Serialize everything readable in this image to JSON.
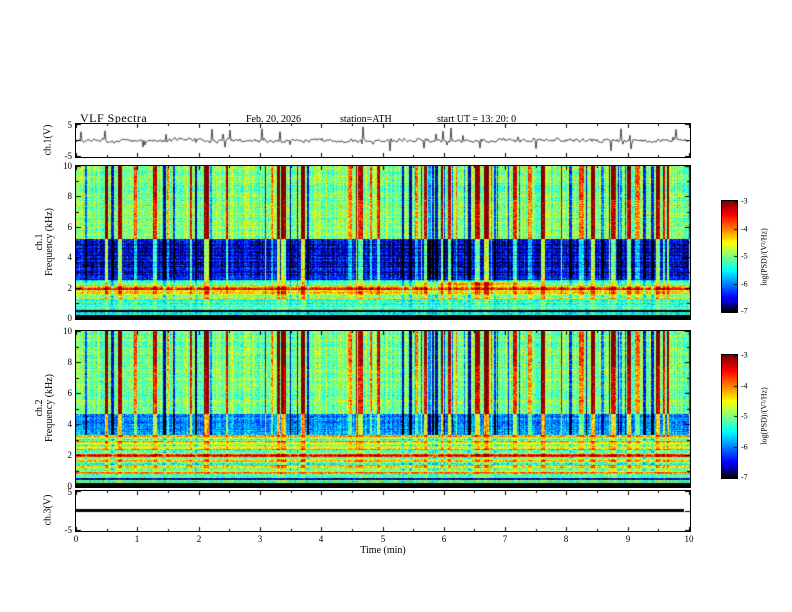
{
  "title": "VLF Spectra",
  "header": {
    "date": "Feb. 20, 2026",
    "station": "station=ATH",
    "start_ut": "start UT =  13: 20: 0"
  },
  "xaxis": {
    "label": "Time (min)",
    "range": [
      0,
      10
    ],
    "ticks": [
      0,
      1,
      2,
      3,
      4,
      5,
      6,
      7,
      8,
      9,
      10
    ]
  },
  "chart_data": [
    {
      "type": "line",
      "name": "ch.1 time series",
      "ylabel": "ch.1(V)",
      "ylim": [
        -5,
        5
      ],
      "yticks": [
        5,
        -5
      ],
      "x_range": [
        0,
        10
      ],
      "description": "Broadband noisy waveform centred on 0 V, typical excursions within about ±1 V, with frequent impulsive spikes reaching roughly ±4 V across the full 10 minutes"
    },
    {
      "type": "heatmap",
      "name": "ch.1 spectrogram",
      "channel": "ch.1",
      "ylabel": "Frequency (kHz)",
      "ylim": [
        0,
        10
      ],
      "yticks": [
        0,
        2,
        4,
        6,
        8,
        10
      ],
      "value_range_log_psd": [
        -7,
        -3
      ],
      "colorbar": {
        "label": "log(PSD)/(V²/Hz)",
        "ticks": [
          -3,
          -4,
          -5,
          -6,
          -7
        ]
      },
      "features": [
        "black band below ~0.2 kHz",
        "bright yellow-green band 1.6-2.1 kHz with an orange line near 2 kHz",
        "dark blue attenuation band ~2.5-5 kHz",
        "mottled green background 5-10 kHz",
        "dense vertical sferic striations spanning the band, strongest (orange/red near -3) above ~8 kHz",
        "occasional dark dropout columns",
        "isolated yellow streak near 2.3 kHz around 5.5-7.5 min"
      ]
    },
    {
      "type": "heatmap",
      "name": "ch.2 spectrogram",
      "channel": "ch.2",
      "ylabel": "Frequency (kHz)",
      "ylim": [
        0,
        10
      ],
      "yticks": [
        0,
        2,
        4,
        6,
        8,
        10
      ],
      "value_range_log_psd": [
        -7,
        -3
      ],
      "colorbar": {
        "label": "log(PSD)/(V²/Hz)",
        "ticks": [
          -3,
          -4,
          -5,
          -6,
          -7
        ]
      },
      "features": [
        "black band below ~0.2 kHz",
        "stack of horizontal harmonic lines 0.3-3.3 kHz with a strong orange line near 2 kHz",
        "blue band ~3.3-4.7 kHz",
        "mottled green background above 4.7 kHz with dense vertical sferic striations"
      ]
    },
    {
      "type": "line",
      "name": "ch.3 time series",
      "ylabel": "ch.3(V)",
      "ylim": [
        -5,
        5
      ],
      "yticks": [
        5,
        -5
      ],
      "x_range": [
        0,
        10
      ],
      "description": "Flat trace at 0 V for the full 10 minutes (thick black line, channel inactive)"
    }
  ]
}
